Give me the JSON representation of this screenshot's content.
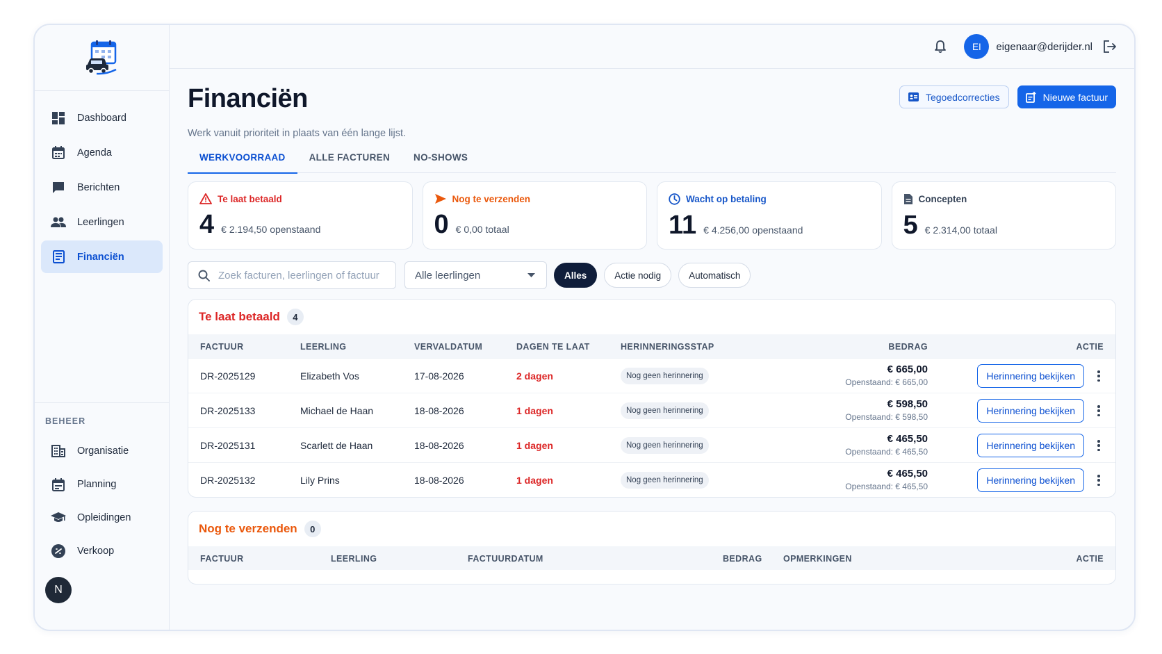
{
  "sidebar": {
    "items": [
      {
        "label": "Dashboard",
        "icon": "dashboard-icon"
      },
      {
        "label": "Agenda",
        "icon": "calendar-icon"
      },
      {
        "label": "Berichten",
        "icon": "chat-icon"
      },
      {
        "label": "Leerlingen",
        "icon": "people-icon"
      },
      {
        "label": "Financiën",
        "icon": "receipt-icon",
        "active": true
      }
    ],
    "section_label": "BEHEER",
    "beheer_items": [
      {
        "label": "Organisatie",
        "icon": "building-icon"
      },
      {
        "label": "Planning",
        "icon": "planning-icon"
      },
      {
        "label": "Opleidingen",
        "icon": "graduation-cap-icon"
      },
      {
        "label": "Verkoop",
        "icon": "sales-icon"
      }
    ],
    "user_initial": "N"
  },
  "topbar": {
    "avatar_initials": "EI",
    "email": "eigenaar@derijder.nl"
  },
  "page": {
    "title": "Financiën",
    "subtitle": "Werk vanuit prioriteit in plaats van één lange lijst.",
    "actions": {
      "credit_label": "Tegoedcorrecties",
      "new_invoice_label": "Nieuwe factuur"
    },
    "tabs": [
      "WERKVOORRAAD",
      "ALLE FACTUREN",
      "NO-SHOWS"
    ],
    "active_tab": 0
  },
  "stats": [
    {
      "label": "Te laat betaald",
      "value": "4",
      "desc": "€ 2.194,50 openstaand",
      "color": "#dc2626",
      "icon": "warning-icon"
    },
    {
      "label": "Nog te verzenden",
      "value": "0",
      "desc": "€ 0,00 totaal",
      "color": "#ea580c",
      "icon": "send-icon"
    },
    {
      "label": "Wacht op betaling",
      "value": "11",
      "desc": "€ 4.256,00 openstaand",
      "color": "#1555c8",
      "icon": "clock-icon"
    },
    {
      "label": "Concepten",
      "value": "5",
      "desc": "€ 2.314,00 totaal",
      "color": "#334155",
      "icon": "document-icon"
    }
  ],
  "filters": {
    "search_placeholder": "Zoek facturen, leerlingen of factuur",
    "select_value": "Alle leerlingen",
    "chips": [
      "Alles",
      "Actie nodig",
      "Automatisch"
    ],
    "active_chip": 0
  },
  "late_section": {
    "title": "Te laat betaald",
    "count": "4",
    "headers": {
      "factuur": "FACTUUR",
      "leerling": "LEERLING",
      "vervaldatum": "VERVALDATUM",
      "dagen": "DAGEN TE LAAT",
      "stap": "HERINNERINGSSTAP",
      "bedrag": "BEDRAG",
      "actie": "ACTIE"
    },
    "rows": [
      {
        "factuur": "DR-2025129",
        "leerling": "Elizabeth Vos",
        "vervaldatum": "17-08-2026",
        "dagen": "2 dagen",
        "stap": "Nog geen herinnering",
        "bedrag": "€ 665,00",
        "openstaand": "Openstaand: € 665,00",
        "actie": "Herinnering bekijken"
      },
      {
        "factuur": "DR-2025133",
        "leerling": "Michael de Haan",
        "vervaldatum": "18-08-2026",
        "dagen": "1 dagen",
        "stap": "Nog geen herinnering",
        "bedrag": "€ 598,50",
        "openstaand": "Openstaand: € 598,50",
        "actie": "Herinnering bekijken"
      },
      {
        "factuur": "DR-2025131",
        "leerling": "Scarlett de Haan",
        "vervaldatum": "18-08-2026",
        "dagen": "1 dagen",
        "stap": "Nog geen herinnering",
        "bedrag": "€ 465,50",
        "openstaand": "Openstaand: € 465,50",
        "actie": "Herinnering bekijken"
      },
      {
        "factuur": "DR-2025132",
        "leerling": "Lily Prins",
        "vervaldatum": "18-08-2026",
        "dagen": "1 dagen",
        "stap": "Nog geen herinnering",
        "bedrag": "€ 465,50",
        "openstaand": "Openstaand: € 465,50",
        "actie": "Herinnering bekijken"
      }
    ]
  },
  "send_section": {
    "title": "Nog te verzenden",
    "count": "0",
    "headers": {
      "factuur": "FACTUUR",
      "leerling": "LEERLING",
      "factuurdatum": "FACTUURDATUM",
      "bedrag": "BEDRAG",
      "opmerkingen": "OPMERKINGEN",
      "actie": "ACTIE"
    }
  },
  "colors": {
    "accent": "#1565e8",
    "danger": "#dc2626",
    "warning": "#ea580c",
    "active_nav_bg": "#dbe8fb",
    "chip_active": "#0f1d3a"
  }
}
